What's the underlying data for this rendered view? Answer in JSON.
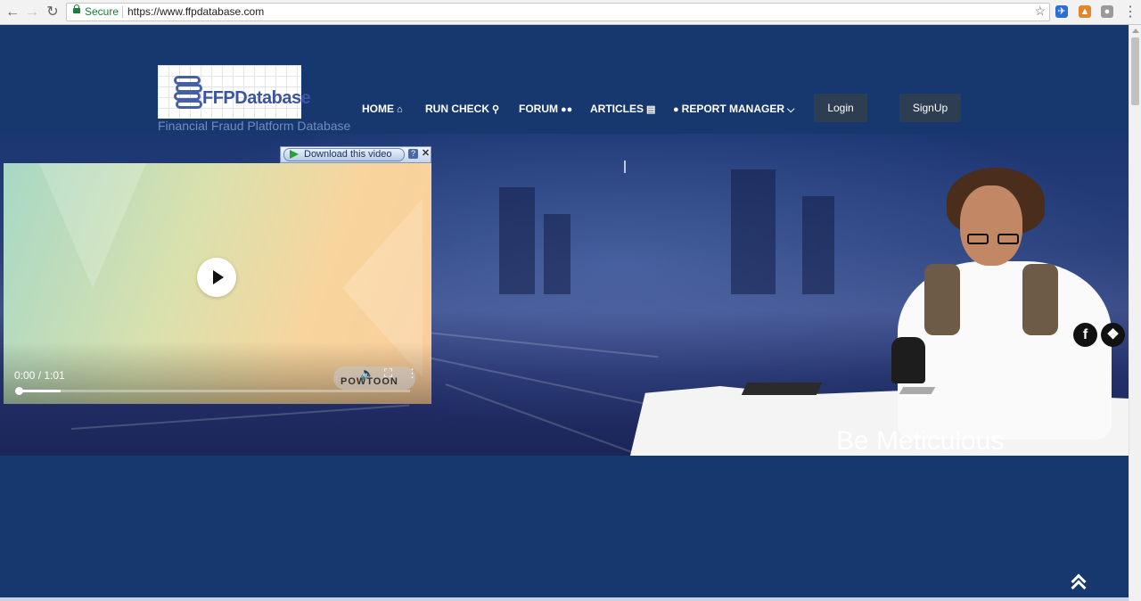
{
  "browser": {
    "secure_label": "Secure",
    "url": "https://www.ffpdatabase.com"
  },
  "site": {
    "logo_text": "FFPDatabase",
    "tagline": "Financial Fraud Platform Database",
    "nav": [
      {
        "label": "HOME",
        "icon": "home-icon"
      },
      {
        "label": "RUN CHECK",
        "icon": "search-icon"
      },
      {
        "label": "FORUM",
        "icon": "users-icon"
      },
      {
        "label": "ARTICLES",
        "icon": "book-icon"
      },
      {
        "label": "REPORT MANAGER",
        "icon": "user-icon"
      }
    ],
    "login_label": "Login",
    "signup_label": "SignUp"
  },
  "video": {
    "download_label": "Download this video",
    "help_label": "?",
    "close_label": "✕",
    "time": "0:00 / 1:01",
    "progress": 0.11,
    "watermark": "POWTOON"
  },
  "hero": {
    "slogan": "Be Meticulous"
  },
  "colors": {
    "page_bg": "#16386f",
    "button_bg": "#2e3e52"
  }
}
